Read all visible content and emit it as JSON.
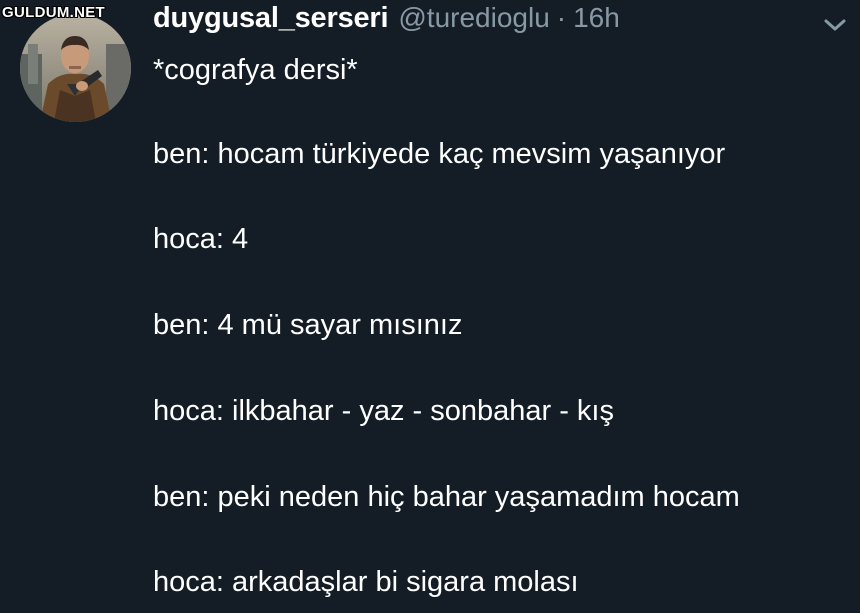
{
  "watermark": {
    "text": "GULDUM.NET"
  },
  "tweet": {
    "display_name": "duygusal_serseri",
    "handle": "@turedioglu",
    "separator": "·",
    "timestamp": "16h",
    "lines": [
      "*cografya dersi*",
      "ben: hocam türkiyede kaç mevsim yaşanıyor",
      "hoca: 4",
      "ben: 4 mü sayar mısınız",
      "hoca: ilkbahar - yaz - sonbahar - kış",
      "ben: peki neden hiç bahar yaşamadım hocam",
      "hoca: arkadaşlar bi sigara molası"
    ]
  },
  "icons": {
    "avatar": "user-avatar",
    "menu": "chevron-down-icon"
  },
  "colors": {
    "background": "#141d26",
    "text_primary": "#ffffff",
    "text_secondary": "#8899a6"
  }
}
